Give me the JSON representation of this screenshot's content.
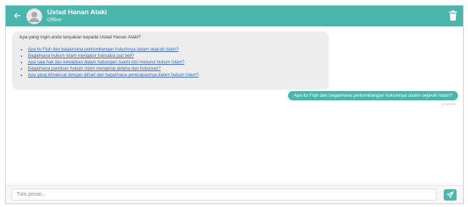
{
  "header": {
    "back_icon": "arrow-left-icon",
    "avatar_icon": "user-avatar-icon",
    "contact_name": "Ustad Hanan Ataki",
    "status": "Offline",
    "delete_icon": "trash-icon"
  },
  "messages": {
    "incoming": {
      "intro": "Apa yang ingin anda tanyakan kepada Ustad Hanan Ataki?",
      "suggestions": [
        "Apa itu Fiqh dan bagaimana perkembangan hukumnya dalam sejarah Islam?",
        "Bagaimana hukum Islam mengatur transaksi jual beli?",
        "Apa saja hak dan kewajiban dalam hubungan suami istri menurut hukum Islam?",
        "Bagaimana panduan hukum Islam mengenai pidana dan hukuman?",
        "Apa yang dimaksud dengan ijtihad dan bagaimana penerapannya dalam hukum Islam?"
      ]
    },
    "outgoing": {
      "text": "Apa itu Fiqh dan bagaimana perkembangan hukumnya dalam sejarah Islam?",
      "time": "07:00 PM"
    }
  },
  "composer": {
    "placeholder": "Tulis pesan...",
    "send_icon": "send-icon"
  },
  "colors": {
    "accent": "#4db6ac",
    "incoming_bubble": "#ededed",
    "link": "#3a66c4"
  }
}
